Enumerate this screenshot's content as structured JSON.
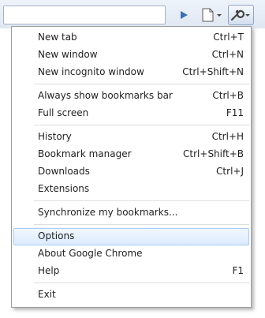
{
  "toolbar": {
    "buttons": [
      {
        "name": "play-icon",
        "color": "#3b6fb6"
      },
      {
        "name": "page-icon"
      },
      {
        "name": "wrench-icon"
      }
    ]
  },
  "menu": {
    "items": [
      {
        "label": "New tab",
        "shortcut": "Ctrl+T"
      },
      {
        "label": "New window",
        "shortcut": "Ctrl+N"
      },
      {
        "label": "New incognito window",
        "shortcut": "Ctrl+Shift+N"
      },
      {
        "label": "Always show bookmarks bar",
        "shortcut": "Ctrl+B"
      },
      {
        "label": "Full screen",
        "shortcut": "F11"
      },
      {
        "label": "History",
        "shortcut": "Ctrl+H"
      },
      {
        "label": "Bookmark manager",
        "shortcut": "Ctrl+Shift+B"
      },
      {
        "label": "Downloads",
        "shortcut": "Ctrl+J"
      },
      {
        "label": "Extensions",
        "shortcut": ""
      },
      {
        "label": "Synchronize my bookmarks...",
        "shortcut": ""
      },
      {
        "label": "Options",
        "shortcut": "",
        "highlighted": true
      },
      {
        "label": "About Google Chrome",
        "shortcut": ""
      },
      {
        "label": "Help",
        "shortcut": "F1"
      },
      {
        "label": "Exit",
        "shortcut": ""
      }
    ]
  },
  "colors": {
    "highlight_border": "#a8cbf2",
    "highlight_fill": "#dcebfd",
    "menu_border": "#9d9d9d"
  }
}
